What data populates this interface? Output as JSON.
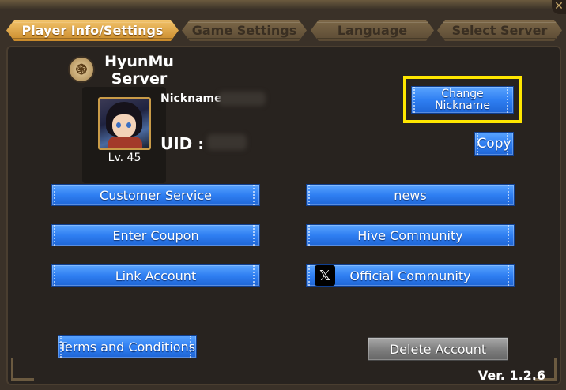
{
  "tabs": [
    {
      "label": "Player Info/Settings",
      "active": true
    },
    {
      "label": "Game Settings",
      "active": false
    },
    {
      "label": "Language",
      "active": false
    },
    {
      "label": "Select Server",
      "active": false
    }
  ],
  "server": {
    "name": "HyunMu Server",
    "icon": "server-emblem-icon"
  },
  "player": {
    "level": "Lv. 45",
    "nickname_label": "Nickname",
    "uid_label": "UID :"
  },
  "buttons": {
    "change_nickname": "Change Nickname",
    "copy": "Copy",
    "customer_service": "Customer Service",
    "news": "news",
    "enter_coupon": "Enter Coupon",
    "hive_community": "Hive Community",
    "link_account": "Link Account",
    "official_community": "Official Community",
    "terms": "Terms and Conditions",
    "delete_account": "Delete Account"
  },
  "icons": {
    "official_community": "x-logo-icon",
    "x_glyph": "𝕏"
  },
  "version": "Ver. 1.2.6",
  "colors": {
    "accent_blue": "#2f7ff2",
    "highlight": "#ffe600",
    "active_tab": "#e0a847"
  }
}
